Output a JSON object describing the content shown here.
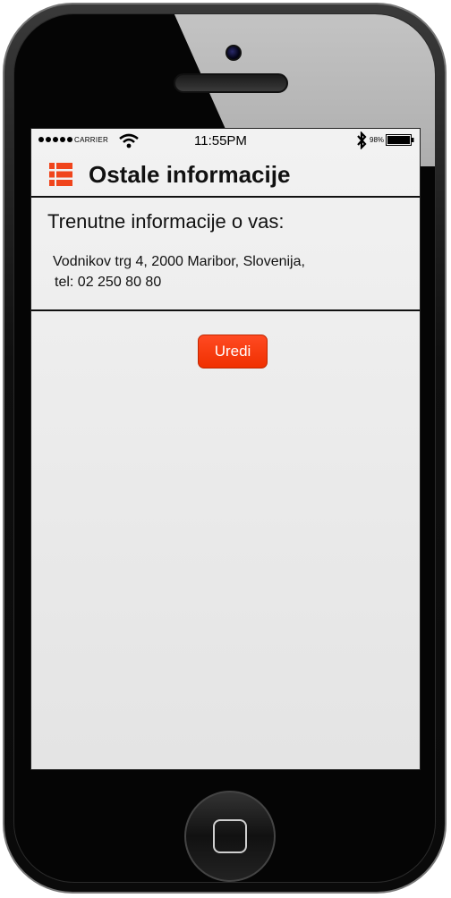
{
  "status_bar": {
    "carrier": "CARRIER",
    "time": "11:55PM",
    "battery": "98%",
    "icons": [
      "signal-dots-icon",
      "wifi-icon",
      "bluetooth-icon",
      "battery-icon"
    ]
  },
  "header": {
    "title": "Ostale informacije",
    "menu_icon": "list-menu-icon",
    "accent_color": "#f0451c"
  },
  "info": {
    "heading": "Trenutne informacije o vas:",
    "address": "Vodnikov trg 4, 2000 Maribor, Slovenija,",
    "phone": "tel: 02 250 80 80"
  },
  "actions": {
    "edit_label": "Uredi",
    "edit_color": "#f03000"
  },
  "device": {
    "home_button_icon": "home-square-icon"
  }
}
